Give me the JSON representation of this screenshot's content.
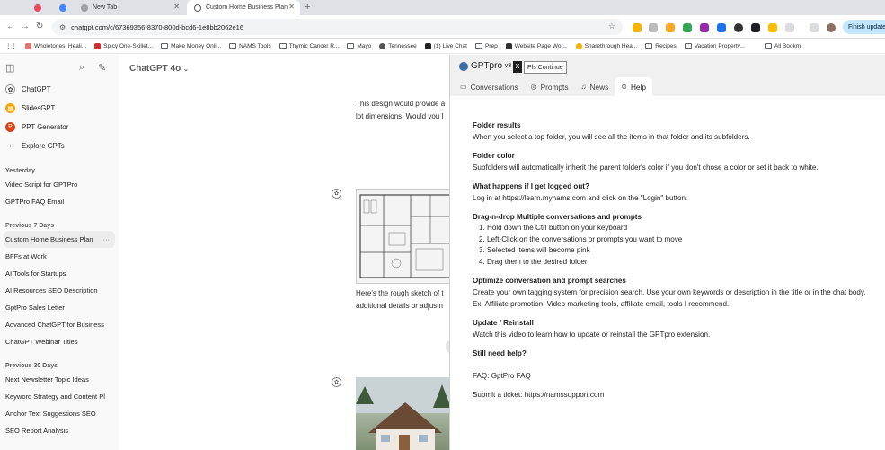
{
  "browser": {
    "tabs": [
      {
        "label": "",
        "active": false
      },
      {
        "label": "",
        "active": false
      },
      {
        "label": "New Tab",
        "active": false
      },
      {
        "label": "Custom Home Business Plan",
        "active": true
      }
    ],
    "url": "chatgpt.com/c/67369356-8370-800d-bcd6-1e8bb2062e16",
    "finish_update": "Finish update",
    "bookmarks": [
      "Wholetones: Heali...",
      "Spicy One-Skillet...",
      "Make Money Onli...",
      "NAMS Tools",
      "Thymic Cancer R...",
      "Mayo",
      "Tennessee",
      "(1) Live Chat",
      "Prep",
      "Website Page Wor...",
      "Sharethrough Hea...",
      "Recipes",
      "Vacation Property...",
      "All Bookm"
    ]
  },
  "sidebar": {
    "gpts": [
      "ChatGPT",
      "SlidesGPT",
      "PPT Generator",
      "Explore GPTs"
    ],
    "sections": [
      {
        "heading": "Yesterday",
        "chats": [
          "Video Script for GPTPro",
          "GPTPro FAQ Email"
        ]
      },
      {
        "heading": "Previous 7 Days",
        "chats": [
          "Custom Home Business Plan",
          "BFFs at Work",
          "AI Tools for Startups",
          "AI Resources SEO Description",
          "GptPro Sales Letter",
          "Advanced ChatGPT for Business",
          "ChatGPT Webinar Titles"
        ]
      },
      {
        "heading": "Previous 30 Days",
        "chats": [
          "Next Newsletter Topic Ideas",
          "Keyword Strategy and Content Pl",
          "Anchor Text Suggestions SEO",
          "SEO Report Analysis"
        ]
      }
    ],
    "more_label": "···"
  },
  "main": {
    "model_label": "ChatGPT 4o",
    "msg1_line1": "This design would provide a",
    "msg1_line2": "lot dimensions. Would you l",
    "msg2_line1": "Here's the rough sketch of t",
    "msg2_line2": "additional details or adjustn"
  },
  "panel": {
    "brand": "GPTpro",
    "version": "v3",
    "x_label": "X",
    "tooltip": "Pls Continue",
    "tabs": [
      "Conversations",
      "Prompts",
      "News",
      "Help"
    ],
    "active_tab": "Help",
    "help": [
      {
        "title": "Folder results",
        "body": "When you select a top folder, you will see all the items in that folder and its subfolders."
      },
      {
        "title": "Folder color",
        "body": "Subfolders will automatically inherit the parent folder's color if you don't chose a color or set it back to white."
      },
      {
        "title": "What happens if I get logged out?",
        "body": "Log in at https://learn.mynams.com and click on the \"Login\" button."
      }
    ],
    "dnd_title": "Drag-n-drop Multiple conversations and prompts",
    "dnd_steps": [
      "Hold down the Ctrl button on your keyboard",
      "Left-Click on the conversations or prompts you want to move",
      "Selected items will become pink",
      "Drag them to the desired folder"
    ],
    "optimize_title": "Optimize conversation and prompt searches",
    "optimize_body": "Create your own tagging system for precision search. Use your own keywords or description in the title or in the chat body. Ex: Affiliate promotion, Video marketing tools, affiliate email, tools I recommend.",
    "update_title": "Update / Reinstall",
    "update_body": "Watch this video to learn how to update or reinstall the GPTpro extension.",
    "still_title": "Still need help?",
    "faq": "FAQ: GptPro FAQ",
    "ticket": "Submit a ticket: https://namssupport.com"
  }
}
